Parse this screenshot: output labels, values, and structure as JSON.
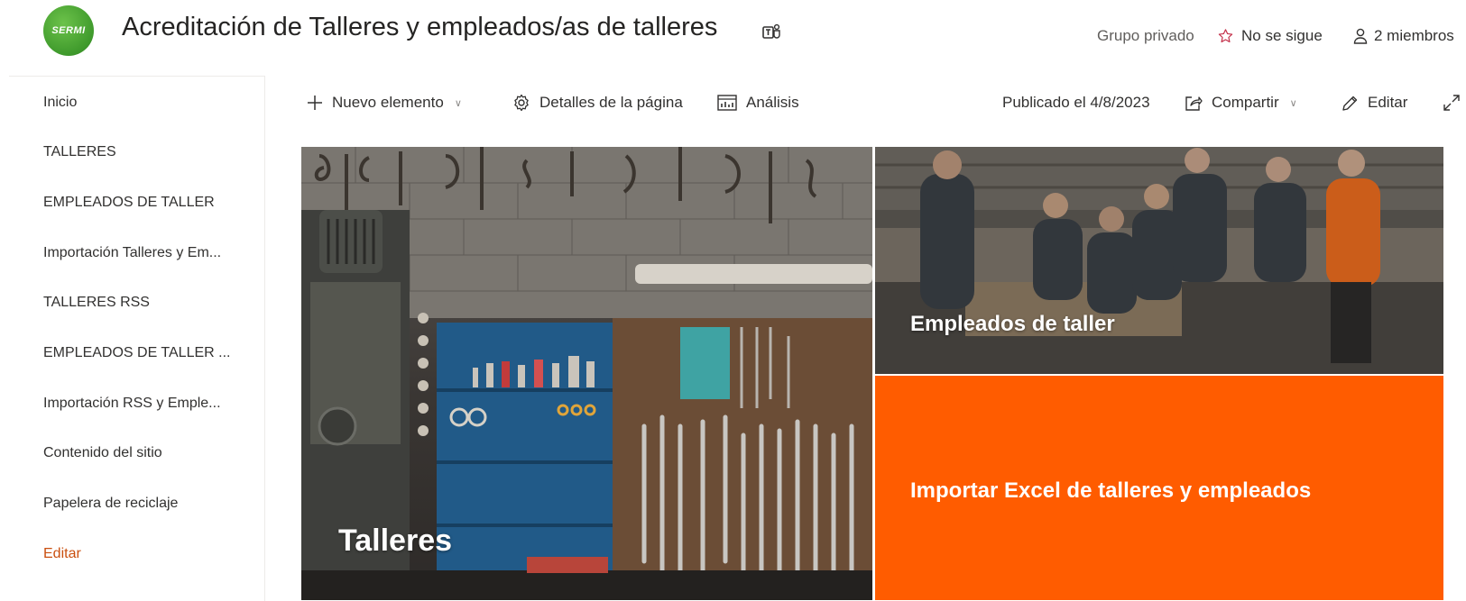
{
  "header": {
    "logo_text": "SERMI",
    "site_title": "Acreditación de Talleres y empleados/as de talleres",
    "privacy": "Grupo privado",
    "follow_label": "No se sigue",
    "members_label": "2 miembros"
  },
  "nav": {
    "items": [
      "Inicio",
      "TALLERES",
      "EMPLEADOS DE TALLER",
      "Importación Talleres y Em...",
      "TALLERES RSS",
      "EMPLEADOS DE TALLER ...",
      "Importación RSS y Emple...",
      "Contenido del sitio",
      "Papelera de reciclaje"
    ],
    "edit_label": "Editar"
  },
  "commandbar": {
    "new_item": "Nuevo elemento",
    "page_details": "Detalles de la página",
    "analytics": "Análisis",
    "published": "Publicado el 4/8/2023",
    "share": "Compartir",
    "edit": "Editar"
  },
  "hero": {
    "main_label": "Talleres",
    "employees_label": "Empleados de taller",
    "import_label": "Importar Excel de talleres y empleados"
  },
  "colors": {
    "accent_orange": "#ff5c00",
    "edit_link": "#ca5010",
    "logo_green": "#4fa83a"
  },
  "icons": [
    "teams-icon",
    "star-icon",
    "person-icon",
    "plus-icon",
    "gear-icon",
    "analytics-icon",
    "share-icon",
    "pencil-icon",
    "expand-icon",
    "chevron-down-icon"
  ]
}
